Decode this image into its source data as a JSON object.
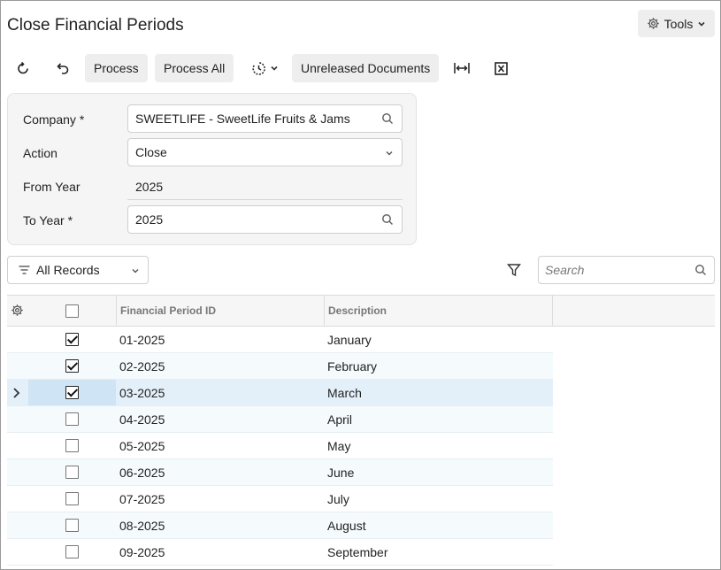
{
  "page": {
    "title": "Close Financial Periods"
  },
  "header": {
    "tools_label": "Tools"
  },
  "toolbar": {
    "process_label": "Process",
    "process_all_label": "Process All",
    "unreleased_label": "Unreleased Documents"
  },
  "form": {
    "company_label": "Company",
    "company_required": "*",
    "company_value": "SWEETLIFE - SweetLife Fruits & Jams",
    "action_label": "Action",
    "action_value": "Close",
    "from_year_label": "From Year",
    "from_year_value": "2025",
    "to_year_label": "To Year",
    "to_year_required": "*",
    "to_year_value": "2025"
  },
  "filter": {
    "label": "All Records"
  },
  "search": {
    "placeholder": "Search"
  },
  "grid": {
    "columns": [
      "Financial Period ID",
      "Description"
    ],
    "rows": [
      {
        "id": "01-2025",
        "desc": "January",
        "checked": true
      },
      {
        "id": "02-2025",
        "desc": "February",
        "checked": true
      },
      {
        "id": "03-2025",
        "desc": "March",
        "checked": true,
        "selected": true
      },
      {
        "id": "04-2025",
        "desc": "April",
        "checked": false
      },
      {
        "id": "05-2025",
        "desc": "May",
        "checked": false
      },
      {
        "id": "06-2025",
        "desc": "June",
        "checked": false
      },
      {
        "id": "07-2025",
        "desc": "July",
        "checked": false
      },
      {
        "id": "08-2025",
        "desc": "August",
        "checked": false
      },
      {
        "id": "09-2025",
        "desc": "September",
        "checked": false
      }
    ]
  }
}
